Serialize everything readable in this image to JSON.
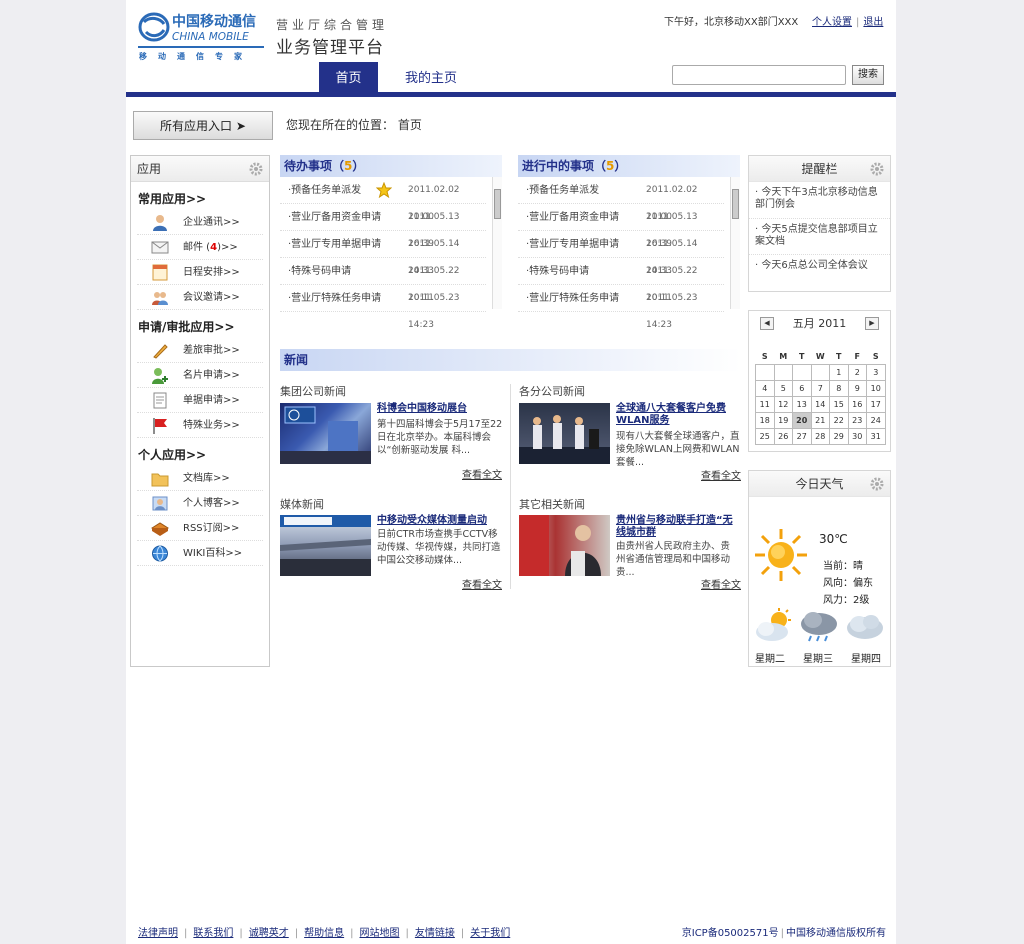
{
  "header": {
    "logo_cn": "中国移动通信",
    "logo_en": "CHINA MOBILE",
    "logo_tag": "移动通信专家",
    "system_subtitle": "营业厅综合管理",
    "system_title": "业务管理平台",
    "greeting": "下午好，北京移动XX部门XXX",
    "personal_settings": "个人设置",
    "logout": "退出",
    "search_placeholder": "",
    "search_button": "搜索"
  },
  "nav": {
    "home": "首页",
    "my_home": "我的主页"
  },
  "breadcrumb": {
    "all_apps": "所有应用入口",
    "location": "您现在所在的位置： 首页"
  },
  "apps": {
    "title": "应用",
    "groups": [
      {
        "title": "常用应用>>",
        "items": [
          {
            "label": "企业通讯>>"
          },
          {
            "label": "邮件",
            "badge": "4"
          },
          {
            "label": "日程安排>>"
          },
          {
            "label": "会议邀请>>"
          }
        ]
      },
      {
        "title": "申请/审批应用>>",
        "items": [
          {
            "label": "差旅审批>>"
          },
          {
            "label": "名片申请>>"
          },
          {
            "label": "单据申请>>"
          },
          {
            "label": "特殊业务>>"
          }
        ]
      },
      {
        "title": "个人应用>>",
        "items": [
          {
            "label": "文档库>>"
          },
          {
            "label": "个人博客>>"
          },
          {
            "label": "RSS订阅>>"
          },
          {
            "label": "WIKI百科>>"
          }
        ]
      }
    ]
  },
  "todo": {
    "title": "待办事项（",
    "count": "5",
    "close": "）",
    "rows": [
      {
        "name": "·预备任务单派发",
        "date": "2011.02.02  11:00"
      },
      {
        "name": "·营业厅备用资金申请",
        "date": "2011.05.13  16:39"
      },
      {
        "name": "·营业厅专用单据申请",
        "date": "2011.05.14  14:33"
      },
      {
        "name": "·特殊号码申请",
        "date": "2011.05.22  10:11"
      },
      {
        "name": "·营业厅特殊任务申请",
        "date": "2011.05.23  14:23"
      }
    ]
  },
  "inprogress": {
    "title": "进行中的事项（",
    "count": "5",
    "close": "）",
    "rows": [
      {
        "name": "·预备任务单派发",
        "date": "2011.02.02  11:00"
      },
      {
        "name": "·营业厅备用资金申请",
        "date": "2011.05.13  16:39"
      },
      {
        "name": "·营业厅专用单据申请",
        "date": "2011.05.14  14:33"
      },
      {
        "name": "·特殊号码申请",
        "date": "2011.05.22  10:11"
      },
      {
        "name": "·营业厅特殊任务申请",
        "date": "2011.05.23  14:23"
      }
    ]
  },
  "news": {
    "title": "新闻",
    "more": "查看全文",
    "blocks": [
      {
        "category": "集团公司新闻",
        "headline": "科博会中国移动展台",
        "body": "第十四届科博会于5月17至22日在北京举办。本届科博会以“创新驱动发展 科..."
      },
      {
        "category": "各分公司新闻",
        "headline": "全球通八大套餐客户免费WLAN服务",
        "body": "现有八大套餐全球通客户，直接免除WLAN上网费和WLAN套餐..."
      },
      {
        "category": "媒体新闻",
        "headline": "中移动受众媒体测量启动",
        "body": "日前CTR市场查携手CCTV移动传媒、华视传媒，共同打造中国公交移动媒体..."
      },
      {
        "category": "其它相关新闻",
        "headline": "贵州省与移动联手打造“无线城市群",
        "body": "由贵州省人民政府主办、贵州省通信管理局和中国移动贵..."
      }
    ]
  },
  "reminders": {
    "title": "提醒栏",
    "items": [
      "· 今天下午3点北京移动信息部门例会",
      "· 今天5点提交信息部项目立案文档",
      "· 今天6点总公司全体会议"
    ]
  },
  "calendar": {
    "month": "五月  2011",
    "weekdays": [
      "S",
      "M",
      "T",
      "W",
      "T",
      "F",
      "S"
    ],
    "weeks": [
      [
        "",
        "",
        "",
        "",
        "1",
        "2",
        "3"
      ],
      [
        "4",
        "5",
        "6",
        "7",
        "8",
        "9",
        "10"
      ],
      [
        "11",
        "12",
        "13",
        "14",
        "15",
        "16",
        "17"
      ],
      [
        "18",
        "19",
        "20",
        "21",
        "22",
        "23",
        "24"
      ],
      [
        "25",
        "26",
        "27",
        "28",
        "29",
        "30",
        "31"
      ]
    ],
    "today": "20"
  },
  "weather": {
    "title": "今日天气",
    "temp": "30℃",
    "now_label": "当前：",
    "now": "晴",
    "wind_dir_label": "风向：",
    "wind_dir": "偏东",
    "wind_force_label": "风力：",
    "wind_force": "2级",
    "forecast": [
      {
        "day": "星期二",
        "icon": "partly-cloudy-icon"
      },
      {
        "day": "星期三",
        "icon": "rain-cloud-icon"
      },
      {
        "day": "星期四",
        "icon": "cloudy-icon"
      }
    ]
  },
  "footer": {
    "links": [
      "法律声明",
      "联系我们",
      "诚聘英才",
      "帮助信息",
      "网站地图",
      "友情链接",
      "关于我们"
    ],
    "icp": "京ICP备05002571号",
    "copyright": "中国移动通信版权所有"
  },
  "colors": {
    "brand": "#23318a",
    "accent": "#e59a00",
    "alert": "#dd0000"
  }
}
